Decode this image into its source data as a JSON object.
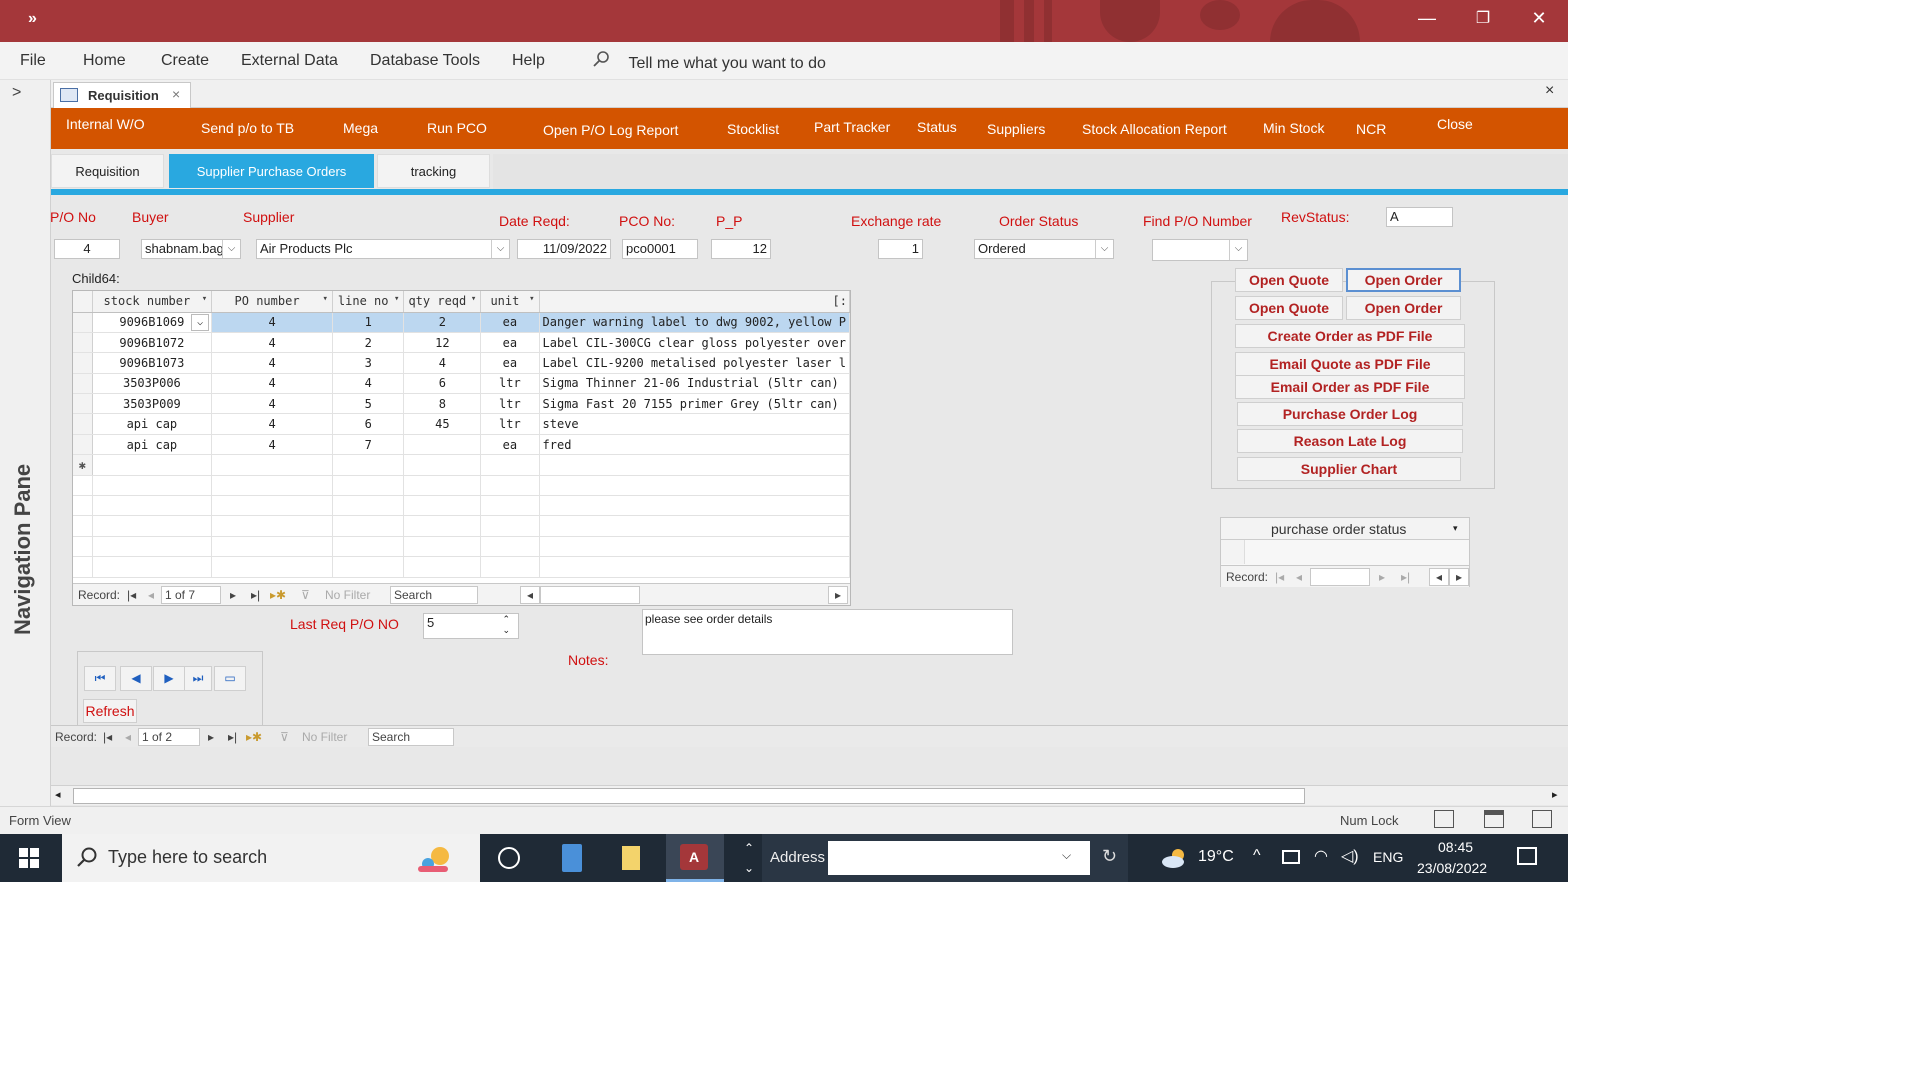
{
  "titlebar": {
    "overflow_glyph": "»",
    "minimize": "—",
    "restore": "❐",
    "close": "✕"
  },
  "menu": {
    "items": [
      "File",
      "Home",
      "Create",
      "External Data",
      "Database Tools",
      "Help"
    ],
    "tell_me": "Tell me what you want to do"
  },
  "navpane": {
    "title": "Navigation Pane",
    "expand": ">"
  },
  "doc_tab": {
    "label": "Requisition",
    "close": "×"
  },
  "doc_close": "×",
  "orange_menu": [
    "Internal W/O",
    "Send p/o to TB",
    "Mega",
    "Run PCO",
    "Open P/O Log Report",
    "Stocklist",
    "Part Tracker",
    "Status",
    "Suppliers",
    "Stock Allocation Report",
    "Min Stock",
    "NCR",
    "Close"
  ],
  "tabs": [
    {
      "label": "Requisition",
      "active": false
    },
    {
      "label": "Supplier Purchase Orders",
      "active": true
    },
    {
      "label": "tracking",
      "active": false
    }
  ],
  "header_fields": {
    "po_no": {
      "label": "P/O No",
      "value": "4"
    },
    "buyer": {
      "label": "Buyer",
      "value": "shabnam.bag"
    },
    "supplier": {
      "label": "Supplier",
      "value": "Air Products Plc"
    },
    "date_reqd": {
      "label": "Date Reqd:",
      "value": "11/09/2022"
    },
    "pco_no": {
      "label": "PCO No:",
      "value": "pco0001"
    },
    "p_p": {
      "label": "P_P",
      "value": "12"
    },
    "exchange_rate": {
      "label": "Exchange rate",
      "value": "1"
    },
    "order_status": {
      "label": "Order Status",
      "value": "Ordered"
    },
    "find_po": {
      "label": "Find P/O Number",
      "value": ""
    },
    "rev_status": {
      "label": "RevStatus:",
      "value": "A"
    }
  },
  "subform": {
    "label": "Child64:",
    "columns": [
      "stock number",
      "PO number",
      "line no",
      "qty reqd",
      "unit",
      "[:"
    ],
    "rows": [
      [
        "9096B1069",
        "4",
        "1",
        "2",
        "ea",
        "Danger warning label to dwg 9002, yellow P"
      ],
      [
        "9096B1072",
        "4",
        "2",
        "12",
        "ea",
        "Label CIL-300CG clear gloss polyester over"
      ],
      [
        "9096B1073",
        "4",
        "3",
        "4",
        "ea",
        "Label CIL-9200 metalised polyester laser l"
      ],
      [
        "3503P006",
        "4",
        "4",
        "6",
        "ltr",
        "Sigma Thinner 21-06 Industrial (5ltr can)"
      ],
      [
        "3503P009",
        "4",
        "5",
        "8",
        "ltr",
        "Sigma Fast 20 7155 primer Grey (5ltr can)"
      ],
      [
        "api cap",
        "4",
        "6",
        "45",
        "ltr",
        "steve"
      ],
      [
        "api cap",
        "4",
        "7",
        "",
        "ea",
        "fred"
      ]
    ],
    "new_row_marker": "✱",
    "nav": {
      "record_label": "Record:",
      "position": "1 of 7",
      "filter": "No Filter",
      "search": "Search"
    }
  },
  "buttons": [
    "Open Quote",
    "Open Order",
    "Open Quote",
    "Open Order",
    "Create Order as PDF File",
    "Email Quote as PDF File",
    "Email Order as PDF File",
    "Purchase Order Log",
    "Reason Late Log",
    "Supplier Chart"
  ],
  "po_status_subform": {
    "column": "purchase order status",
    "record_label": "Record:"
  },
  "last_req": {
    "label": "Last Req P/O NO",
    "value": "5"
  },
  "notes": {
    "label": "Notes:",
    "value": "please see order details"
  },
  "refresh_label": "Refresh",
  "main_nav": {
    "record_label": "Record:",
    "position": "1 of 2",
    "filter": "No Filter",
    "search": "Search"
  },
  "statusbar": {
    "view": "Form View",
    "numlock": "Num Lock"
  },
  "taskbar": {
    "search_placeholder": "Type here to search",
    "address_label": "Address",
    "weather": "19°C",
    "language": "ENG",
    "time": "08:45",
    "date": "23/08/2022"
  },
  "colors": {
    "title": "#a4373a",
    "orange_menu": "#d35400",
    "tab_active": "#29a8e0",
    "label_red": "#d01010",
    "button_text": "#b22222"
  }
}
